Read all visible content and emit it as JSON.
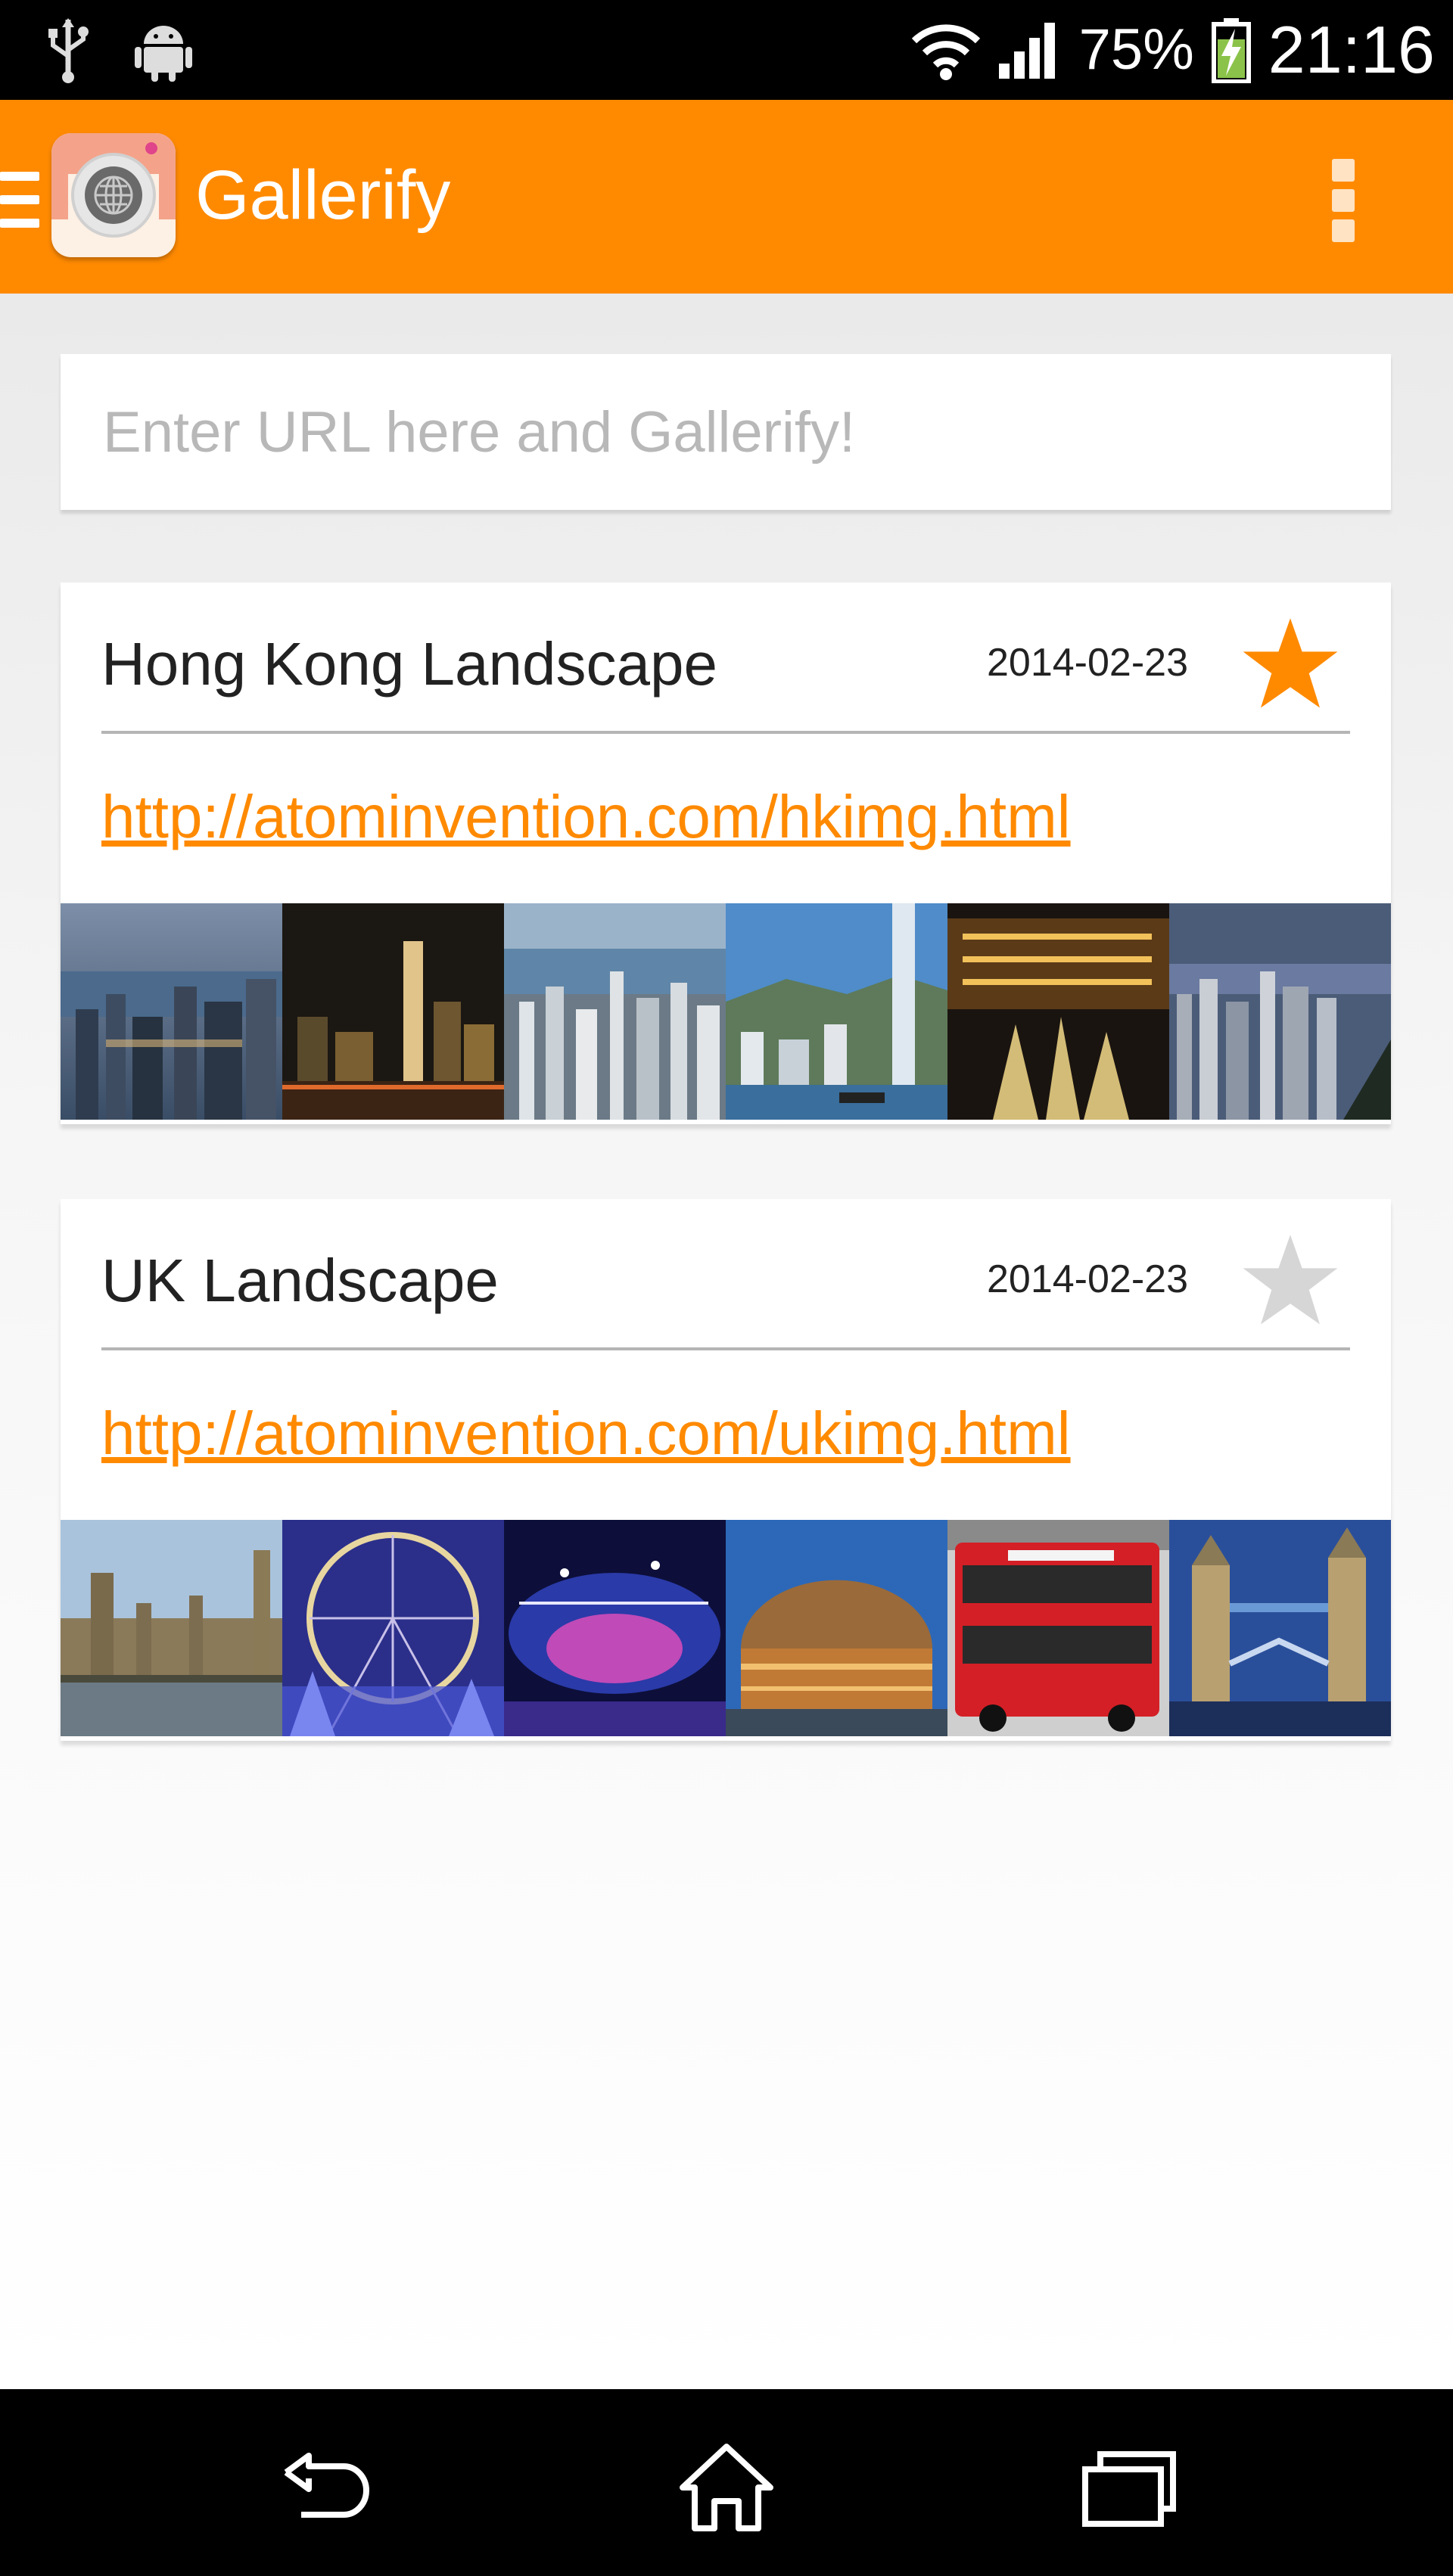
{
  "status_bar": {
    "icons": [
      "usb-icon",
      "android-icon",
      "wifi-icon",
      "signal-icon",
      "battery-charging-icon"
    ],
    "battery": "75%",
    "time": "21:16"
  },
  "app_bar": {
    "title": "Gallerify",
    "accent_color": "#ff8a00",
    "icons": [
      "menu-icon",
      "app-logo-icon",
      "overflow-menu-icon"
    ]
  },
  "search": {
    "placeholder": "Enter URL here and Gallerify!",
    "value": ""
  },
  "galleries": [
    {
      "title": "Hong Kong Landscape",
      "date": "2014-02-23",
      "url": "http://atominvention.com/hkimg.html",
      "starred": true,
      "thumbnail_count": 6
    },
    {
      "title": "UK Landscape",
      "date": "2014-02-23",
      "url": "http://atominvention.com/ukimg.html",
      "starred": false,
      "thumbnail_count": 6
    }
  ],
  "nav_bar": {
    "icons": [
      "back-icon",
      "home-icon",
      "recent-apps-icon"
    ]
  }
}
